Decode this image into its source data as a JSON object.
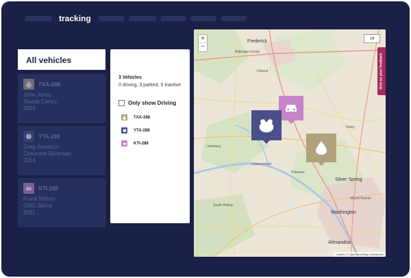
{
  "header": {
    "title": "tracking"
  },
  "sidebar": {
    "all_label": "All vehicles",
    "vehicles": [
      {
        "plate": "TXA-288",
        "driver": "John Jones",
        "model": "Toyota Camry",
        "year": "2009",
        "icon": "droplet-icon",
        "color": "#b0a27a"
      },
      {
        "plate": "YTA-288",
        "driver": "Greg Jameson",
        "model": "Chevrolet Silverado",
        "year": "2014",
        "icon": "frog-icon",
        "color": "#4a4f8c"
      },
      {
        "plate": "KTI-288",
        "driver": "Frank Wilson",
        "model": "GMC Sierra",
        "year": "2011",
        "icon": "car-icon",
        "color": "#c784c9"
      }
    ]
  },
  "details": {
    "count": "3 Vehicles",
    "summary": "0 driving, 3 parked, 0 inactive",
    "filter_label": "Only show Driving",
    "plates": [
      "TXA-288",
      "YTA-288",
      "KTI-288"
    ]
  },
  "map": {
    "zoom_in": "+",
    "zoom_out": "−",
    "toggle": "Off",
    "feedback": "Give us your feedback",
    "attribution": "Leaflet | © OpenStreetMap contributors",
    "places": {
      "frederick": "Frederick",
      "ballenger": "Ballenger Creek",
      "urbana": "Urbana",
      "leesburg": "Leesburg",
      "olney": "Olney",
      "potomac": "Potomac",
      "silver_spring": "Silver Spring",
      "mount_rainier": "Mount Rainier",
      "washington": "Washington",
      "alexandria": "Alexandria",
      "lowes_island": "Lowes Island",
      "south_riding": "South Riding"
    }
  }
}
